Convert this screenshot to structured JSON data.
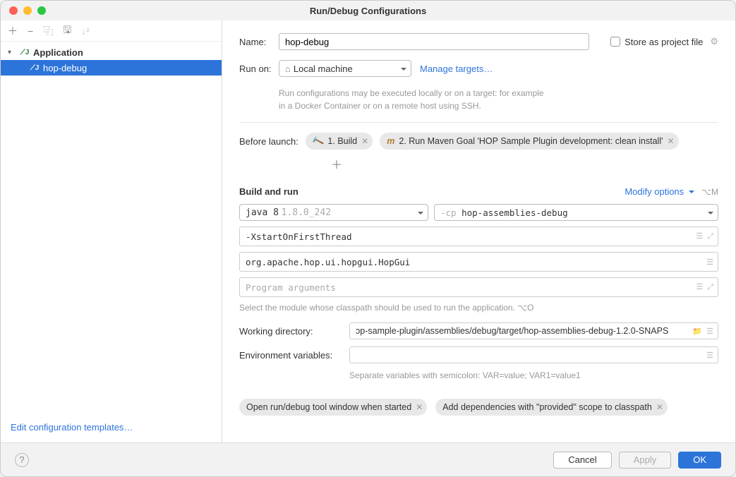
{
  "window": {
    "title": "Run/Debug Configurations"
  },
  "sidebar": {
    "root": "Application",
    "items": [
      "hop-debug"
    ],
    "footer_link": "Edit configuration templates…"
  },
  "form": {
    "name_label": "Name:",
    "name_value": "hop-debug",
    "store_label": "Store as project file",
    "run_on_label": "Run on:",
    "run_on_value": "Local machine",
    "manage_targets": "Manage targets…",
    "run_on_hint": "Run configurations may be executed locally or on a target: for example in a Docker Container or on a remote host using SSH.",
    "before_launch_label": "Before launch:",
    "before1": "1. Build",
    "before2": "2. Run Maven Goal 'HOP Sample Plugin development: clean install'",
    "build_run_title": "Build and run",
    "modify_options": "Modify options",
    "modify_shortcut": "⌥M",
    "java_label": "java 8",
    "java_version": "1.8.0_242",
    "cp_flag": "-cp",
    "cp_value": "hop-assemblies-debug",
    "vm_options": "-XstartOnFirstThread",
    "main_class": "org.apache.hop.ui.hopgui.HopGui",
    "program_args_placeholder": "Program arguments",
    "module_hint": "Select the module whose classpath should be used to run the application.",
    "module_shortcut": "⌥O",
    "wd_label": "Working directory:",
    "wd_value": "ɔp-sample-plugin/assemblies/debug/target/hop-assemblies-debug-1.2.0-SNAPS",
    "env_label": "Environment variables:",
    "env_hint": "Separate variables with semicolon: VAR=value; VAR1=value1",
    "chip1": "Open run/debug tool window when started",
    "chip2": "Add dependencies with \"provided\" scope to classpath"
  },
  "footer": {
    "cancel": "Cancel",
    "apply": "Apply",
    "ok": "OK"
  }
}
